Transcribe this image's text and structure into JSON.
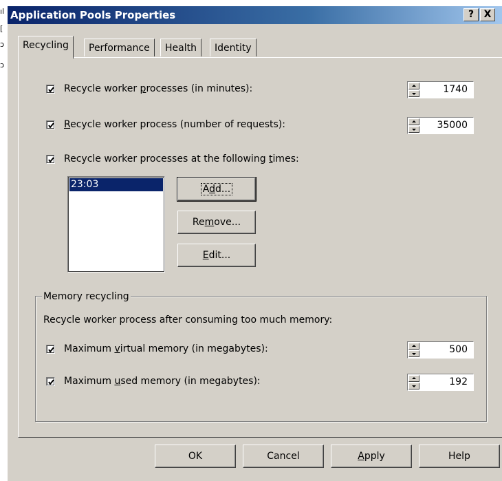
{
  "background_window": {
    "fragments": [
      "ıl",
      "[",
      "ɔ",
      "ɔ"
    ]
  },
  "dialog": {
    "title": "Application Pools Properties",
    "help_button": "?",
    "close_button": "X"
  },
  "tabs": [
    {
      "label": "Recycling",
      "active": true
    },
    {
      "label": "Performance",
      "active": false
    },
    {
      "label": "Health",
      "active": false
    },
    {
      "label": "Identity",
      "active": false
    }
  ],
  "recycling": {
    "minutes": {
      "checked": true,
      "label_pre": "Recycle worker ",
      "label_u": "p",
      "label_post": "rocesses (in minutes):",
      "value": "1740"
    },
    "requests": {
      "checked": true,
      "label_pre": "",
      "label_u": "R",
      "label_post": "ecycle worker process (number of requests):",
      "value": "35000"
    },
    "times": {
      "checked": true,
      "label_pre": "Recycle worker processes at the following ",
      "label_u": "t",
      "label_post": "imes:",
      "items": [
        "23:03"
      ]
    },
    "buttons": {
      "add": {
        "pre": "A",
        "u": "d",
        "post": "d..."
      },
      "remove": {
        "pre": "Re",
        "u": "m",
        "post": "ove..."
      },
      "edit": {
        "pre": "",
        "u": "E",
        "post": "dit..."
      }
    }
  },
  "memory": {
    "group_title": "Memory recycling",
    "description": "Recycle worker process after consuming too much memory:",
    "virtual": {
      "checked": true,
      "label_pre": "Maximum ",
      "label_u": "v",
      "label_post": "irtual memory (in megabytes):",
      "value": "500"
    },
    "used": {
      "checked": true,
      "label_pre": "Maximum ",
      "label_u": "u",
      "label_post": "sed memory (in megabytes):",
      "value": "192"
    }
  },
  "footer": {
    "ok": "OK",
    "cancel": "Cancel",
    "apply_u": "A",
    "apply_post": "pply",
    "help": "Help"
  }
}
